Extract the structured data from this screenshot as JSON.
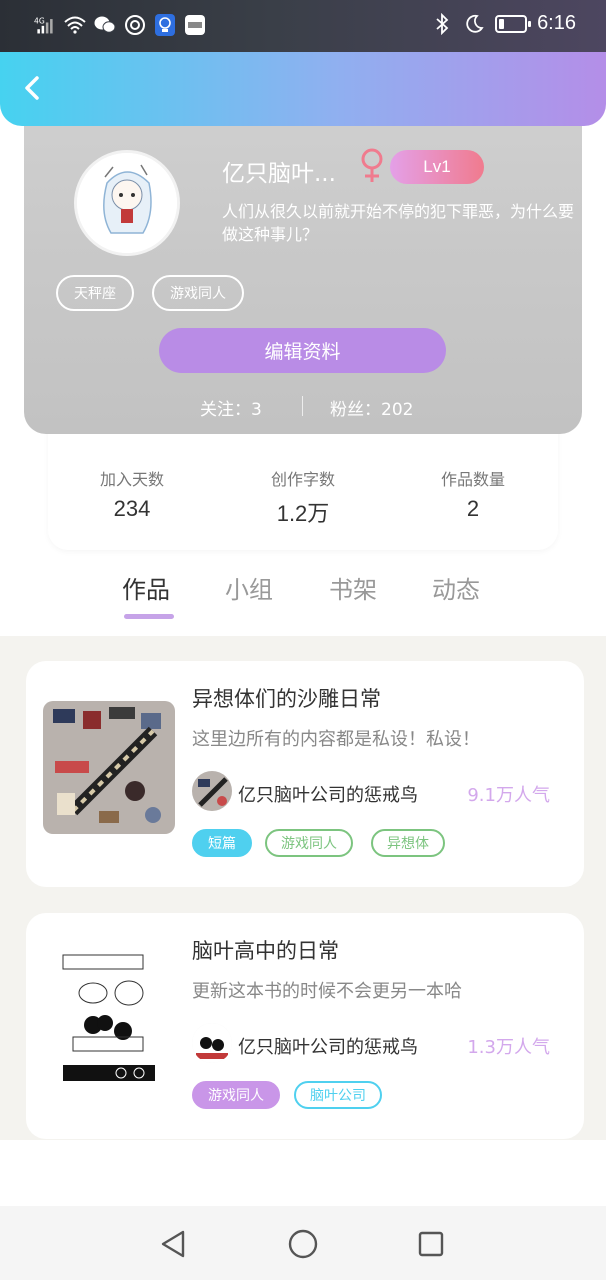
{
  "status_bar": {
    "network": "4G",
    "time": "6:16",
    "battery_level": 0.2,
    "icons": [
      "signal-icon",
      "wifi-icon",
      "wechat-icon",
      "radar-icon",
      "lightbulb-icon",
      "huawei-icon",
      "bluetooth-icon",
      "moon-icon",
      "battery-icon"
    ]
  },
  "header": {
    "back_icon": "chevron-left-icon"
  },
  "profile": {
    "username": "亿只脑叶...",
    "gender": "female",
    "level": "Lv1",
    "signature": "人们从很久以前就开始不停的犯下罪恶，为什么要做这种事儿？",
    "tags": [
      "天秤座",
      "游戏同人"
    ],
    "edit_button": "编辑资料",
    "follow_label": "关注：3",
    "fans_label": "粉丝：202"
  },
  "stats": [
    {
      "label": "加入天数",
      "value": "234"
    },
    {
      "label": "创作字数",
      "value": "1.2万"
    },
    {
      "label": "作品数量",
      "value": "2"
    }
  ],
  "tabs": [
    {
      "label": "作品",
      "active": true
    },
    {
      "label": "小组",
      "active": false
    },
    {
      "label": "书架",
      "active": false
    },
    {
      "label": "动态",
      "active": false
    }
  ],
  "books": [
    {
      "title": "异想体们的沙雕日常",
      "description": "这里边所有的内容都是私设！私设！",
      "author": "亿只脑叶公司的惩戒鸟",
      "popularity": "9.1万人气",
      "tags": [
        {
          "label": "短篇",
          "style": "filled",
          "color": "#4fd0ef"
        },
        {
          "label": "游戏同人",
          "style": "outline",
          "color": "#7cc47f"
        },
        {
          "label": "异想体",
          "style": "outline",
          "color": "#7cc47f"
        }
      ]
    },
    {
      "title": "脑叶高中的日常",
      "description": "更新这本书的时候不会更另一本哈",
      "author": "亿只脑叶公司的惩戒鸟",
      "popularity": "1.3万人气",
      "tags": [
        {
          "label": "游戏同人",
          "style": "filled",
          "color": "#c996e8"
        },
        {
          "label": "脑叶公司",
          "style": "outline",
          "color": "#4fd0ef"
        }
      ]
    }
  ],
  "nav": {
    "icons": [
      "back-triangle-icon",
      "home-circle-icon",
      "recents-square-icon"
    ]
  },
  "colors": {
    "accent_purple": "#b98ce6",
    "header_gradient_start": "#46d2f0",
    "header_gradient_end": "#b48ee8",
    "popularity": "#d3a8ec"
  }
}
